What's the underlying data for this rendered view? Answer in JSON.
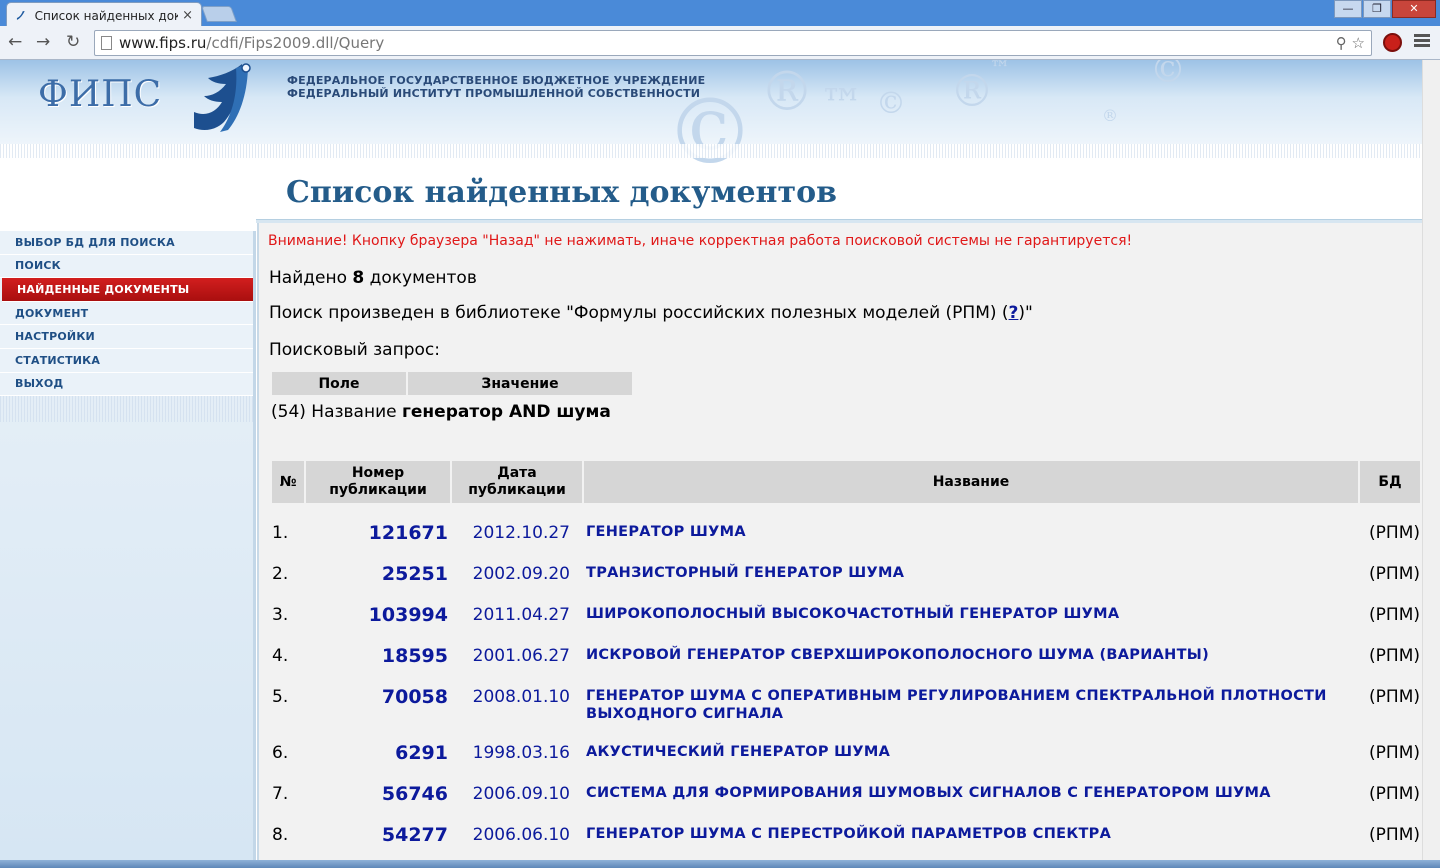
{
  "browser": {
    "tab_title": "Список найденных докум",
    "tab_close": "×",
    "win_minimize": "—",
    "win_maximize": "❐",
    "win_close": "✕",
    "back": "←",
    "forward": "→",
    "reload": "↻",
    "url_host": "www.fips.ru",
    "url_path": "/cdfi/Fips2009.dll/Query",
    "zoom_icon": "⚲",
    "star_icon": "☆"
  },
  "banner": {
    "logo": "ФИПС",
    "org_line1": "ФЕДЕРАЛЬНОЕ ГОСУДАРСТВЕННОЕ БЮДЖЕТНОЕ УЧРЕЖДЕНИЕ",
    "org_line2": "ФЕДЕРАЛЬНЫЙ ИНСТИТУТ ПРОМЫШЛЕННОЙ СОБСТВЕННОСТИ"
  },
  "page_title": "Список найденных документов",
  "sidebar": {
    "items": [
      {
        "label": "ВЫБОР БД ДЛЯ ПОИСКА",
        "active": false
      },
      {
        "label": "ПОИСК",
        "active": false
      },
      {
        "label": "НАЙДЕННЫЕ ДОКУМЕНТЫ",
        "active": true
      },
      {
        "label": "ДОКУМЕНТ",
        "active": false
      },
      {
        "label": "НАСТРОЙКИ",
        "active": false
      },
      {
        "label": "СТАТИСТИКА",
        "active": false
      },
      {
        "label": "ВЫХОД",
        "active": false
      }
    ]
  },
  "content": {
    "warning": "Внимание! Кнопку браузера \"Назад\" не нажимать, иначе корректная работа поисковой системы не гарантируется!",
    "found_prefix": "Найдено ",
    "found_count": "8",
    "found_suffix": " документов",
    "library_prefix": "Поиск произведен в библиотеке \"Формулы российских полезных моделей (РПМ) (",
    "library_help": "?",
    "library_suffix": ")\"",
    "query_label": "Поисковый запрос:",
    "query_table": {
      "col_field": "Поле",
      "col_value": "Значение"
    },
    "query_row": {
      "field": "(54) Название ",
      "value": "генератор AND шума"
    },
    "results": {
      "headers": {
        "num": "№",
        "pub_number": "Номер публикации",
        "pub_date": "Дата публикации",
        "title": "Название",
        "db": "БД"
      },
      "rows": [
        {
          "num": "1.",
          "pub": "121671",
          "date": "2012.10.27",
          "title": "ГЕНЕРАТОР ШУМА",
          "db": "(РПМ)"
        },
        {
          "num": "2.",
          "pub": "25251",
          "date": "2002.09.20",
          "title": "ТРАНЗИСТОРНЫЙ ГЕНЕРАТОР ШУМА",
          "db": "(РПМ)"
        },
        {
          "num": "3.",
          "pub": "103994",
          "date": "2011.04.27",
          "title": "ШИРОКОПОЛОСНЫЙ ВЫСОКОЧАСТОТНЫЙ ГЕНЕРАТОР ШУМА",
          "db": "(РПМ)"
        },
        {
          "num": "4.",
          "pub": "18595",
          "date": "2001.06.27",
          "title": "ИСКРОВОЙ ГЕНЕРАТОР СВЕРХШИРОКОПОЛОСНОГО ШУМА (ВАРИАНТЫ)",
          "db": "(РПМ)"
        },
        {
          "num": "5.",
          "pub": "70058",
          "date": "2008.01.10",
          "title": "ГЕНЕРАТОР ШУМА С ОПЕРАТИВНЫМ РЕГУЛИРОВАНИЕМ СПЕКТРАЛЬНОЙ ПЛОТНОСТИ ВЫХОДНОГО СИГНАЛА",
          "db": "(РПМ)"
        },
        {
          "num": "6.",
          "pub": "6291",
          "date": "1998.03.16",
          "title": "АКУСТИЧЕСКИЙ ГЕНЕРАТОР ШУМА",
          "db": "(РПМ)"
        },
        {
          "num": "7.",
          "pub": "56746",
          "date": "2006.09.10",
          "title": "СИСТЕМА ДЛЯ ФОРМИРОВАНИЯ ШУМОВЫХ СИГНАЛОВ С ГЕНЕРАТОРОМ ШУМА",
          "db": "(РПМ)"
        },
        {
          "num": "8.",
          "pub": "54277",
          "date": "2006.06.10",
          "title": "ГЕНЕРАТОР ШУМА С ПЕРЕСТРОЙКОЙ ПАРАМЕТРОВ СПЕКТРА",
          "db": "(РПМ)"
        }
      ]
    }
  },
  "colors": {
    "accent_red": "#d21e1e",
    "link_blue": "#0c1a9c",
    "title_blue": "#245c8a",
    "warning_red": "#e01818"
  }
}
